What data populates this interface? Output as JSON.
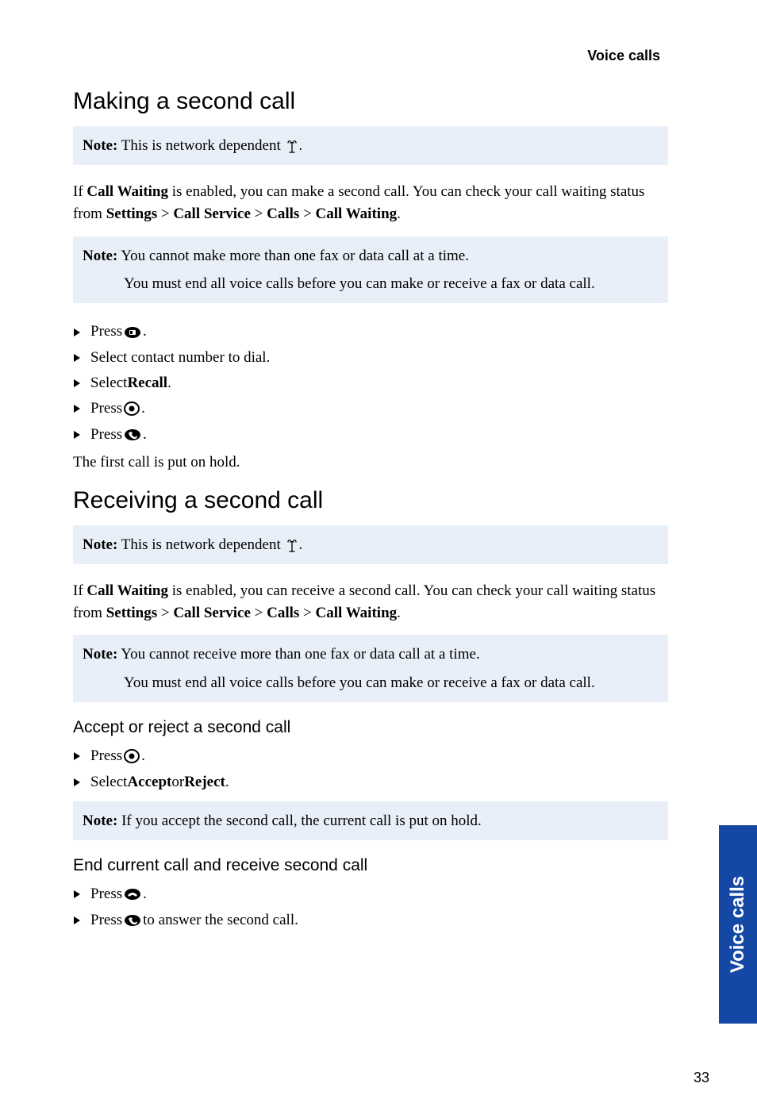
{
  "running_head": "Voice calls",
  "section1": {
    "title": "Making a second call",
    "note1_label": "Note:",
    "note1_text": " This is network dependent ",
    "note1_suffix": ".",
    "body_prefix": "If ",
    "body_cw": "Call Waiting",
    "body_mid": " is enabled, you can make a second call. You can check your call waiting status from ",
    "path_settings": "Settings",
    "path_cs": "Call Service",
    "path_calls": "Calls",
    "path_cw": "Call Waiting",
    "gt": " > ",
    "period": ".",
    "note2_label": "Note:",
    "note2_line1": " You cannot make more than one fax or data call at a time.",
    "note2_line2": "You must end all voice calls before you can make or receive a fax or data call.",
    "steps": {
      "s1_a": "Press ",
      "s2": "Select contact number to dial.",
      "s3_a": "Select ",
      "s3_b": "Recall",
      "s4_a": "Press ",
      "s5_a": "Press "
    },
    "after": "The first call is put on hold."
  },
  "section2": {
    "title": "Receiving a second call",
    "note1_label": "Note:",
    "note1_text": " This is network dependent ",
    "note1_suffix": ".",
    "body_prefix": "If ",
    "body_cw": "Call Waiting",
    "body_mid": " is enabled, you can receive a second call. You can check your call waiting status from ",
    "path_settings": "Settings",
    "path_cs": "Call Service",
    "path_calls": "Calls",
    "path_cw": "Call Waiting",
    "gt": " > ",
    "period": ".",
    "note2_label": "Note:",
    "note2_line1": " You cannot receive more than one fax or data call at a time.",
    "note2_line2": "You must end all voice calls before you can make or receive a fax or data call.",
    "sub1": "Accept or reject a second call",
    "sub1_steps": {
      "s1_a": "Press ",
      "s2_a": "Select ",
      "s2_b": "Accept",
      "s2_mid": " or ",
      "s2_c": "Reject"
    },
    "note3_label": "Note:",
    "note3_text": " If you accept the second call, the current call is put on hold.",
    "sub2": "End current call and receive second call",
    "sub2_steps": {
      "s1_a": "Press ",
      "s2_a": "Press ",
      "s2_b": " to answer the second call."
    }
  },
  "side_tab": "Voice calls",
  "page_number": "33"
}
